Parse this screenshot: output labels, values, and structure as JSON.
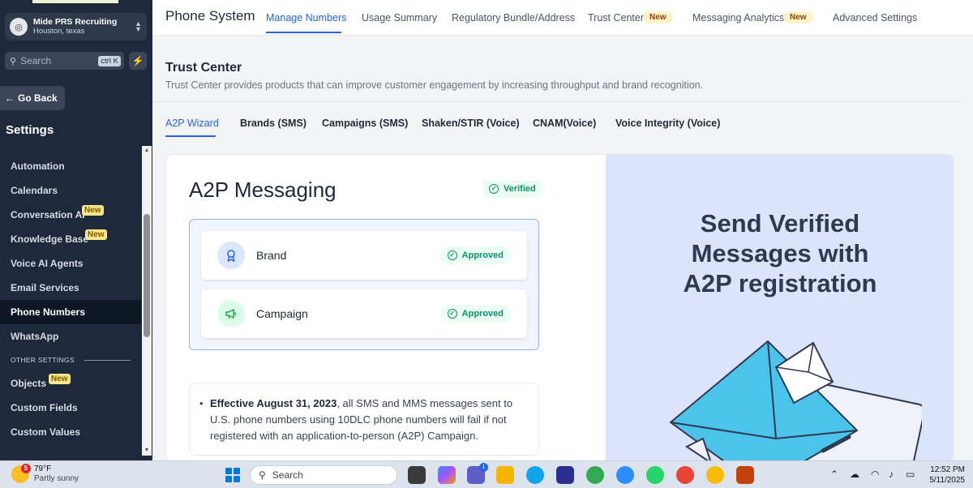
{
  "sidebar": {
    "location_name": "Mide PRS Recruiting",
    "location_sub": "Houston, texas",
    "search_placeholder": "Search",
    "search_shortcut": "ctrl K",
    "back_label": "Go Back",
    "settings_title": "Settings",
    "items": [
      {
        "label": "Automation"
      },
      {
        "label": "Calendars"
      },
      {
        "label": "Conversation AI",
        "badge": "New"
      },
      {
        "label": "Knowledge Base",
        "badge": "New"
      },
      {
        "label": "Voice AI Agents"
      },
      {
        "label": "Email Services"
      },
      {
        "label": "Phone Numbers",
        "active": true
      },
      {
        "label": "WhatsApp"
      }
    ],
    "section_other": "OTHER SETTINGS",
    "other_items": [
      {
        "label": "Objects",
        "badge": "New"
      },
      {
        "label": "Custom Fields"
      },
      {
        "label": "Custom Values"
      }
    ]
  },
  "topnav": {
    "title": "Phone System",
    "tabs": [
      {
        "label": "Manage Numbers",
        "active": true
      },
      {
        "label": "Usage Summary"
      },
      {
        "label": "Regulatory Bundle/Address"
      },
      {
        "label": "Trust Center",
        "badge": "New"
      },
      {
        "label": "Messaging Analytics",
        "badge": "New"
      },
      {
        "label": "Advanced Settings"
      }
    ]
  },
  "trust_center": {
    "title": "Trust Center",
    "description": "Trust Center provides products that can improve customer engagement by increasing throughput and brand recognition.",
    "subtabs": [
      {
        "label": "A2P Wizard",
        "active": true
      },
      {
        "label": "Brands (SMS)"
      },
      {
        "label": "Campaigns (SMS)"
      },
      {
        "label": "Shaken/STIR (Voice)"
      },
      {
        "label": "CNAM(Voice)"
      },
      {
        "label": "Voice Integrity (Voice)"
      }
    ]
  },
  "a2p": {
    "title": "A2P Messaging",
    "verified_label": "Verified",
    "steps": [
      {
        "label": "Brand",
        "status": "Approved",
        "icon": "award-icon"
      },
      {
        "label": "Campaign",
        "status": "Approved",
        "icon": "megaphone-icon"
      }
    ],
    "notice_bold": "Effective August 31, 2023",
    "notice_rest": ", all SMS and MMS messages sent to U.S. phone numbers using 10DLC phone numbers will fail if not registered with an application-to-person (A2P) Campaign.",
    "promo_line1": "Send Verified",
    "promo_line2": "Messages with",
    "promo_line3": "A2P registration"
  },
  "taskbar": {
    "temperature": "79°F",
    "weather": "Partly sunny",
    "weather_alert_count": "5",
    "search_label": "Search",
    "teams_badge": "1",
    "time": "12:52 PM",
    "date": "5/11/2025"
  },
  "colors": {
    "sidebar_bg": "#1e2a3b",
    "accent": "#2563eb",
    "success": "#059669",
    "promo_bg": "#dbe4fa",
    "envelope": "#4cc3ea"
  }
}
